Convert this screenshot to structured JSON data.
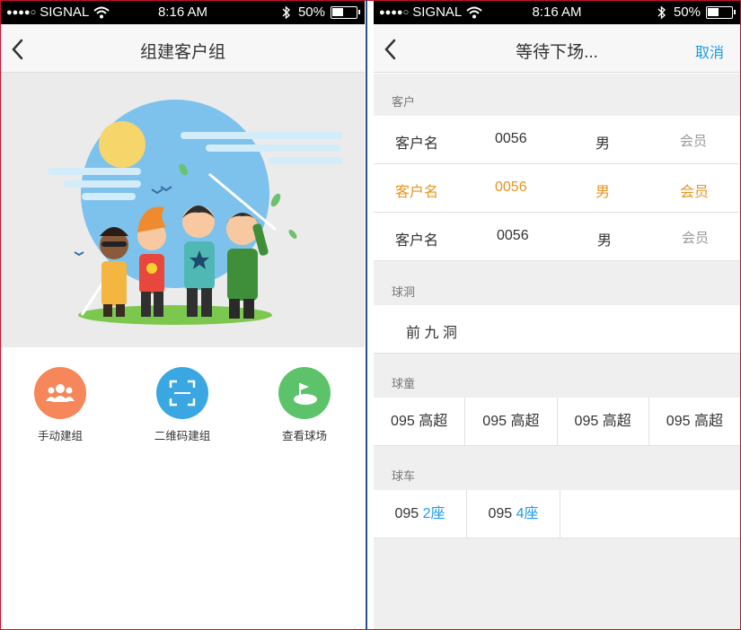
{
  "status_bar": {
    "carrier": "SIGNAL",
    "time": "8:16 AM",
    "battery": "50%"
  },
  "left_screen": {
    "title": "组建客户组",
    "actions": [
      {
        "label": "手动建组",
        "icon": "group-icon",
        "color": "#f5875a"
      },
      {
        "label": "二维码建组",
        "icon": "qr-scan-icon",
        "color": "#3aa7e3"
      },
      {
        "label": "查看球场",
        "icon": "golf-course-icon",
        "color": "#5dc36b"
      }
    ]
  },
  "right_screen": {
    "title": "等待下场...",
    "cancel_label": "取消",
    "sections": {
      "customers": {
        "label": "客户",
        "rows": [
          {
            "name": "客户名",
            "number": "0056",
            "gender": "男",
            "type": "会员"
          },
          {
            "name": "客户名",
            "number": "0056",
            "gender": "男",
            "type": "会员"
          },
          {
            "name": "客户名",
            "number": "0056",
            "gender": "男",
            "type": "会员"
          }
        ]
      },
      "holes": {
        "label": "球洞",
        "value": "前 九 洞"
      },
      "caddies": {
        "label": "球童",
        "items": [
          "095 高超",
          "095 高超",
          "095 高超",
          "095 高超"
        ]
      },
      "carts": {
        "label": "球车",
        "items": [
          {
            "number": "095",
            "seats": "2座"
          },
          {
            "number": "095",
            "seats": "4座"
          }
        ]
      }
    }
  },
  "colors": {
    "accent_blue": "#1e9be3",
    "highlight_orange": "#e8941e"
  }
}
